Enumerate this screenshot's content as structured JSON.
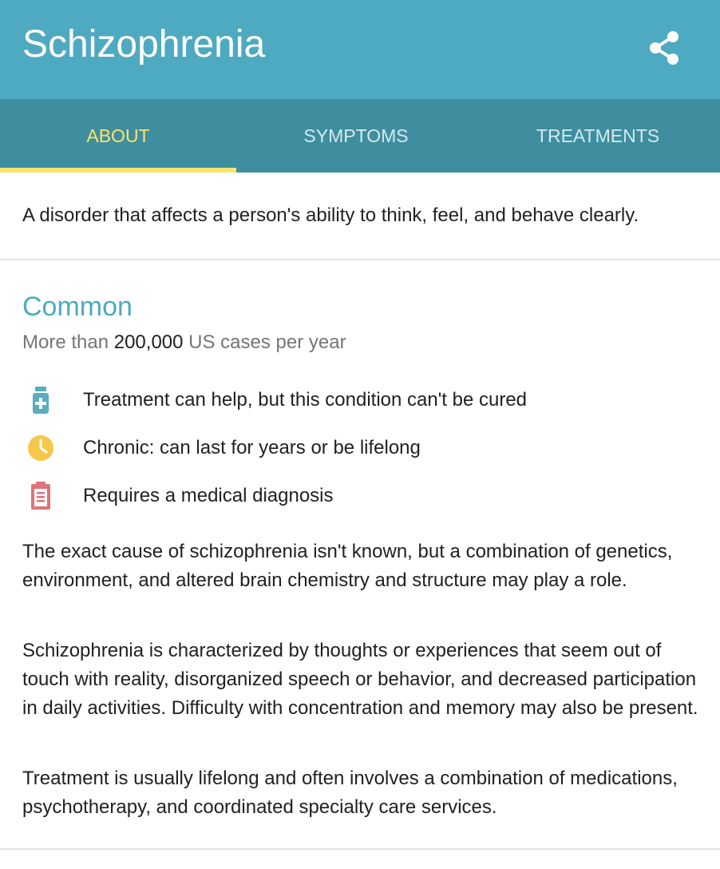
{
  "header": {
    "title": "Schizophrenia",
    "share_icon": "share-icon",
    "background": "#4eaac0"
  },
  "tabs": [
    {
      "label": "ABOUT",
      "active": true
    },
    {
      "label": "SYMPTOMS",
      "active": false
    },
    {
      "label": "TREATMENTS",
      "active": false
    }
  ],
  "colors": {
    "tab_bar": "#3f8e9f",
    "active_tab": "#fde36a",
    "inactive_tab": "#d3eaf0",
    "accent": "#4eaac0"
  },
  "summary": "A disorder that affects a person's ability to think, feel, and behave clearly.",
  "prevalence": {
    "heading": "Common",
    "prefix": "More than",
    "count": "200,000",
    "suffix": "US cases per year"
  },
  "facts": [
    {
      "icon": "medicine-bottle-icon",
      "color": "#5aadbd",
      "text": "Treatment can help, but this condition can't be cured"
    },
    {
      "icon": "clock-icon",
      "color": "#f5c84a",
      "text": "Chronic: can last for years or be lifelong"
    },
    {
      "icon": "clipboard-icon",
      "color": "#e07278",
      "text": "Requires a medical diagnosis"
    }
  ],
  "paragraphs": [
    "The exact cause of schizophrenia isn't known, but a combination of genetics, environment, and altered brain chemistry and structure may play a role.",
    "Schizophrenia is characterized by thoughts or experiences that seem out of touch with reality, disorganized speech or behavior, and decreased participation in daily activities. Difficulty with concentration and memory may also be present.",
    "Treatment is usually lifelong and often involves a combination of medications, psychotherapy, and coordinated specialty care services."
  ]
}
